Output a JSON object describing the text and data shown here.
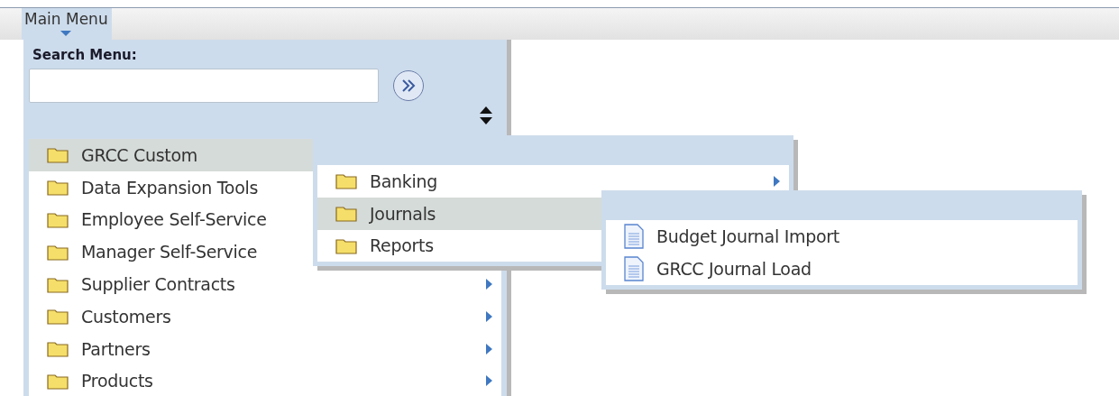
{
  "menu_bar": {
    "tab": "Main Menu"
  },
  "search": {
    "label": "Search Menu:"
  },
  "main_menu": {
    "items": [
      {
        "label": "GRCC Custom",
        "kind": "folder",
        "selected": true,
        "arrow": false
      },
      {
        "label": "Data Expansion Tools",
        "kind": "folder",
        "selected": false,
        "arrow": false
      },
      {
        "label": "Employee Self-Service",
        "kind": "folder",
        "selected": false,
        "arrow": false
      },
      {
        "label": "Manager Self-Service",
        "kind": "folder",
        "selected": false,
        "arrow": false
      },
      {
        "label": "Supplier Contracts",
        "kind": "folder",
        "selected": false,
        "arrow": true
      },
      {
        "label": "Customers",
        "kind": "folder",
        "selected": false,
        "arrow": true
      },
      {
        "label": "Partners",
        "kind": "folder",
        "selected": false,
        "arrow": true
      },
      {
        "label": "Products",
        "kind": "folder",
        "selected": false,
        "arrow": true
      }
    ]
  },
  "submenus": [
    {
      "items": [
        {
          "label": "Banking",
          "kind": "folder",
          "selected": false,
          "arrow": true
        },
        {
          "label": "Journals",
          "kind": "folder",
          "selected": true,
          "arrow": false
        },
        {
          "label": "Reports",
          "kind": "folder",
          "selected": false,
          "arrow": false
        }
      ]
    },
    {
      "items": [
        {
          "label": "Budget Journal Import",
          "kind": "page",
          "selected": false,
          "arrow": false
        },
        {
          "label": "GRCC Journal Load",
          "kind": "page",
          "selected": false,
          "arrow": false
        }
      ]
    }
  ]
}
